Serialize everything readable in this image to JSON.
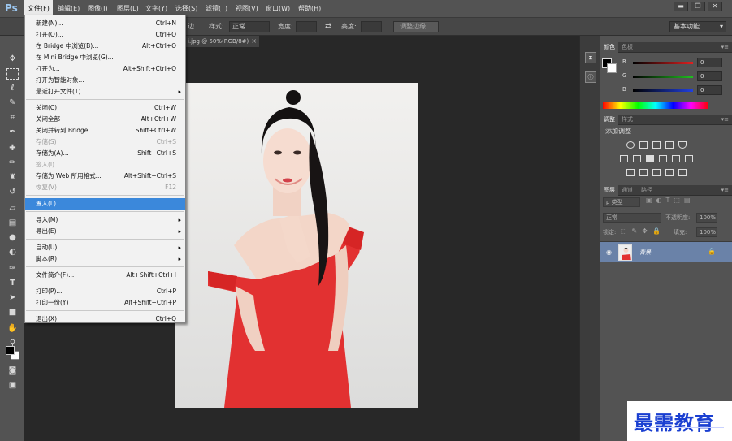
{
  "app": {
    "logo": "Ps"
  },
  "menubar": {
    "items": [
      {
        "label": "文件(F)"
      },
      {
        "label": "编辑(E)"
      },
      {
        "label": "图像(I)"
      },
      {
        "label": "图层(L)"
      },
      {
        "label": "文字(Y)"
      },
      {
        "label": "选择(S)"
      },
      {
        "label": "滤镜(T)"
      },
      {
        "label": "视图(V)"
      },
      {
        "label": "窗口(W)"
      },
      {
        "label": "帮助(H)"
      }
    ],
    "window_controls": [
      "▬",
      "❐",
      "✕"
    ]
  },
  "options_bar": {
    "refine_stub": "边",
    "style_label": "样式:",
    "style_value": "正常",
    "width_label": "宽度:",
    "height_label": "高度:",
    "refine_edge": "调整边缘...",
    "workspace": "基本功能"
  },
  "document": {
    "tab_title": "i.jpg @ 50%(RGB/8#)",
    "close": "×"
  },
  "file_menu": {
    "items": [
      {
        "type": "item",
        "label": "新建(N)...",
        "shortcut": "Ctrl+N"
      },
      {
        "type": "item",
        "label": "打开(O)...",
        "shortcut": "Ctrl+O"
      },
      {
        "type": "item",
        "label": "在 Bridge 中浏览(B)...",
        "shortcut": "Alt+Ctrl+O"
      },
      {
        "type": "item",
        "label": "在 Mini Bridge 中浏览(G)...",
        "shortcut": ""
      },
      {
        "type": "item",
        "label": "打开为...",
        "shortcut": "Alt+Shift+Ctrl+O"
      },
      {
        "type": "item",
        "label": "打开为智能对象...",
        "shortcut": ""
      },
      {
        "type": "item",
        "label": "最近打开文件(T)",
        "shortcut": "",
        "submenu": true
      },
      {
        "type": "sep"
      },
      {
        "type": "item",
        "label": "关闭(C)",
        "shortcut": "Ctrl+W"
      },
      {
        "type": "item",
        "label": "关闭全部",
        "shortcut": "Alt+Ctrl+W"
      },
      {
        "type": "item",
        "label": "关闭并转到 Bridge...",
        "shortcut": "Shift+Ctrl+W"
      },
      {
        "type": "item",
        "label": "存储(S)",
        "shortcut": "Ctrl+S",
        "disabled": true
      },
      {
        "type": "item",
        "label": "存储为(A)...",
        "shortcut": "Shift+Ctrl+S"
      },
      {
        "type": "item",
        "label": "签入(I)...",
        "shortcut": "",
        "disabled": true
      },
      {
        "type": "item",
        "label": "存储为 Web 所用格式...",
        "shortcut": "Alt+Shift+Ctrl+S"
      },
      {
        "type": "item",
        "label": "恢复(V)",
        "shortcut": "F12",
        "disabled": true
      },
      {
        "type": "sep"
      },
      {
        "type": "item",
        "label": "置入(L)...",
        "shortcut": "",
        "highlight": true
      },
      {
        "type": "sep"
      },
      {
        "type": "item",
        "label": "导入(M)",
        "shortcut": "",
        "submenu": true
      },
      {
        "type": "item",
        "label": "导出(E)",
        "shortcut": "",
        "submenu": true
      },
      {
        "type": "sep"
      },
      {
        "type": "item",
        "label": "自动(U)",
        "shortcut": "",
        "submenu": true
      },
      {
        "type": "item",
        "label": "脚本(R)",
        "shortcut": "",
        "submenu": true
      },
      {
        "type": "sep"
      },
      {
        "type": "item",
        "label": "文件简介(F)...",
        "shortcut": "Alt+Shift+Ctrl+I"
      },
      {
        "type": "sep"
      },
      {
        "type": "item",
        "label": "打印(P)...",
        "shortcut": "Ctrl+P"
      },
      {
        "type": "item",
        "label": "打印一份(Y)",
        "shortcut": "Alt+Shift+Ctrl+P"
      },
      {
        "type": "sep"
      },
      {
        "type": "item",
        "label": "退出(X)",
        "shortcut": "Ctrl+Q"
      }
    ]
  },
  "color_panel": {
    "tabs": [
      "颜色",
      "色板"
    ],
    "channels": [
      {
        "letter": "R",
        "value": "0",
        "color": "#e02020"
      },
      {
        "letter": "G",
        "value": "0",
        "color": "#20c020"
      },
      {
        "letter": "B",
        "value": "0",
        "color": "#2040e0"
      }
    ]
  },
  "adjustments_panel": {
    "tabs": [
      "调整",
      "样式"
    ],
    "title": "添加调整"
  },
  "layers_panel": {
    "tabs": [
      "图层",
      "通道",
      "路径"
    ],
    "kind_filter": "ρ 类型",
    "blend_mode": "正常",
    "opacity_label": "不透明度:",
    "opacity_value": "100%",
    "lock_label": "锁定:",
    "fill_label": "填充:",
    "fill_value": "100%",
    "layer_name": "背景"
  },
  "watermark": {
    "text": "最需教育"
  },
  "icons": {
    "toolbar": [
      "move-icon",
      "marquee-icon",
      "lasso-icon",
      "quick-select-icon",
      "crop-icon",
      "eyedropper-icon",
      "healing-brush-icon",
      "brush-icon",
      "clone-stamp-icon",
      "history-brush-icon",
      "eraser-icon",
      "gradient-icon",
      "blur-icon",
      "dodge-icon",
      "pen-icon",
      "type-icon",
      "path-select-icon",
      "shape-icon",
      "hand-icon",
      "zoom-icon"
    ]
  }
}
